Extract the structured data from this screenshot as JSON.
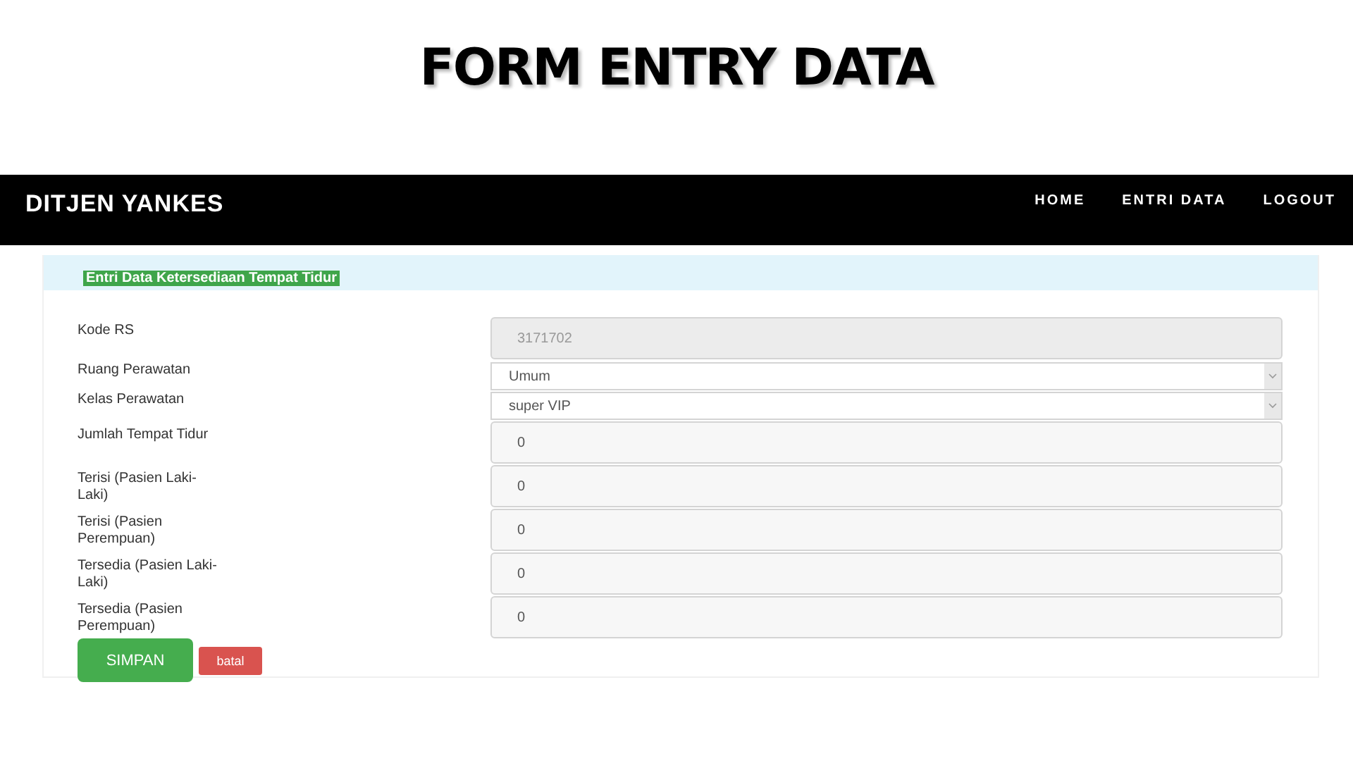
{
  "slide_title": "FORM ENTRY DATA",
  "navbar": {
    "brand": "DITJEN YANKES",
    "links": [
      "HOME",
      "ENTRI DATA",
      "LOGOUT"
    ]
  },
  "panel": {
    "heading": "Entri Data Ketersediaan Tempat Tidur",
    "fields": [
      {
        "label": "Kode RS",
        "kind": "readonly",
        "value": "3171702"
      },
      {
        "label": "Ruang Perawatan",
        "kind": "select",
        "value": "Umum"
      },
      {
        "label": "Kelas Perawatan",
        "kind": "select",
        "value": "super VIP"
      },
      {
        "label": "Jumlah Tempat Tidur",
        "kind": "input",
        "value": "0"
      },
      {
        "label": "Terisi (Pasien Laki-Laki)",
        "kind": "input",
        "value": "0"
      },
      {
        "label": "Terisi (Pasien Perempuan)",
        "kind": "input",
        "value": "0"
      },
      {
        "label": "Tersedia (Pasien Laki-Laki)",
        "kind": "input",
        "value": "0"
      },
      {
        "label": "Tersedia (Pasien Perempuan)",
        "kind": "input",
        "value": "0"
      }
    ],
    "buttons": [
      {
        "label": "SIMPAN",
        "kind": "primary"
      },
      {
        "label": "batal",
        "kind": "danger"
      }
    ]
  }
}
